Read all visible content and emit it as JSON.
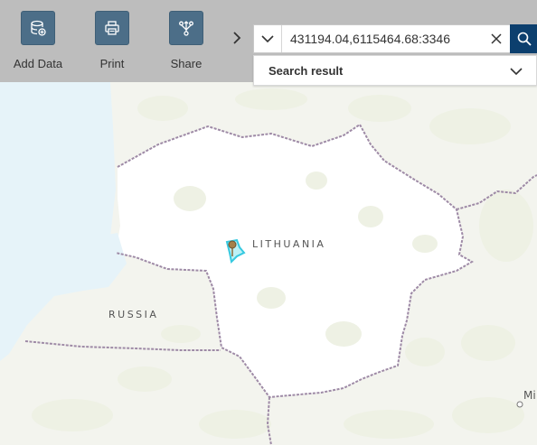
{
  "toolbar": {
    "add_data": {
      "label": "Add Data",
      "icon": "database-add-icon"
    },
    "print": {
      "label": "Print",
      "icon": "printer-icon"
    },
    "share": {
      "label": "Share",
      "icon": "share-icon"
    },
    "expand_icon": "chevron-right-icon"
  },
  "search": {
    "value": "431194.04,6115464.68:3346",
    "source_icon": "chevron-down-icon",
    "clear_icon": "close-icon",
    "search_icon": "search-icon"
  },
  "result_panel": {
    "title": "Search result",
    "toggle_icon": "chevron-down-icon"
  },
  "map": {
    "labels": {
      "lithuania": "LITHUANIA",
      "russia": "RUSSIA",
      "minsk": "Mi"
    },
    "marker_icon": "map-pin-icon",
    "colors": {
      "water": "#e6f3f9",
      "land": "#ffffff",
      "vegetation": "#eef1e4",
      "border": "#9e8aa6",
      "highlight": "#36c9e0",
      "toolbar": "#bdbdbd",
      "tool_button": "#4c6e88",
      "search_button": "#0c3f6e"
    }
  }
}
